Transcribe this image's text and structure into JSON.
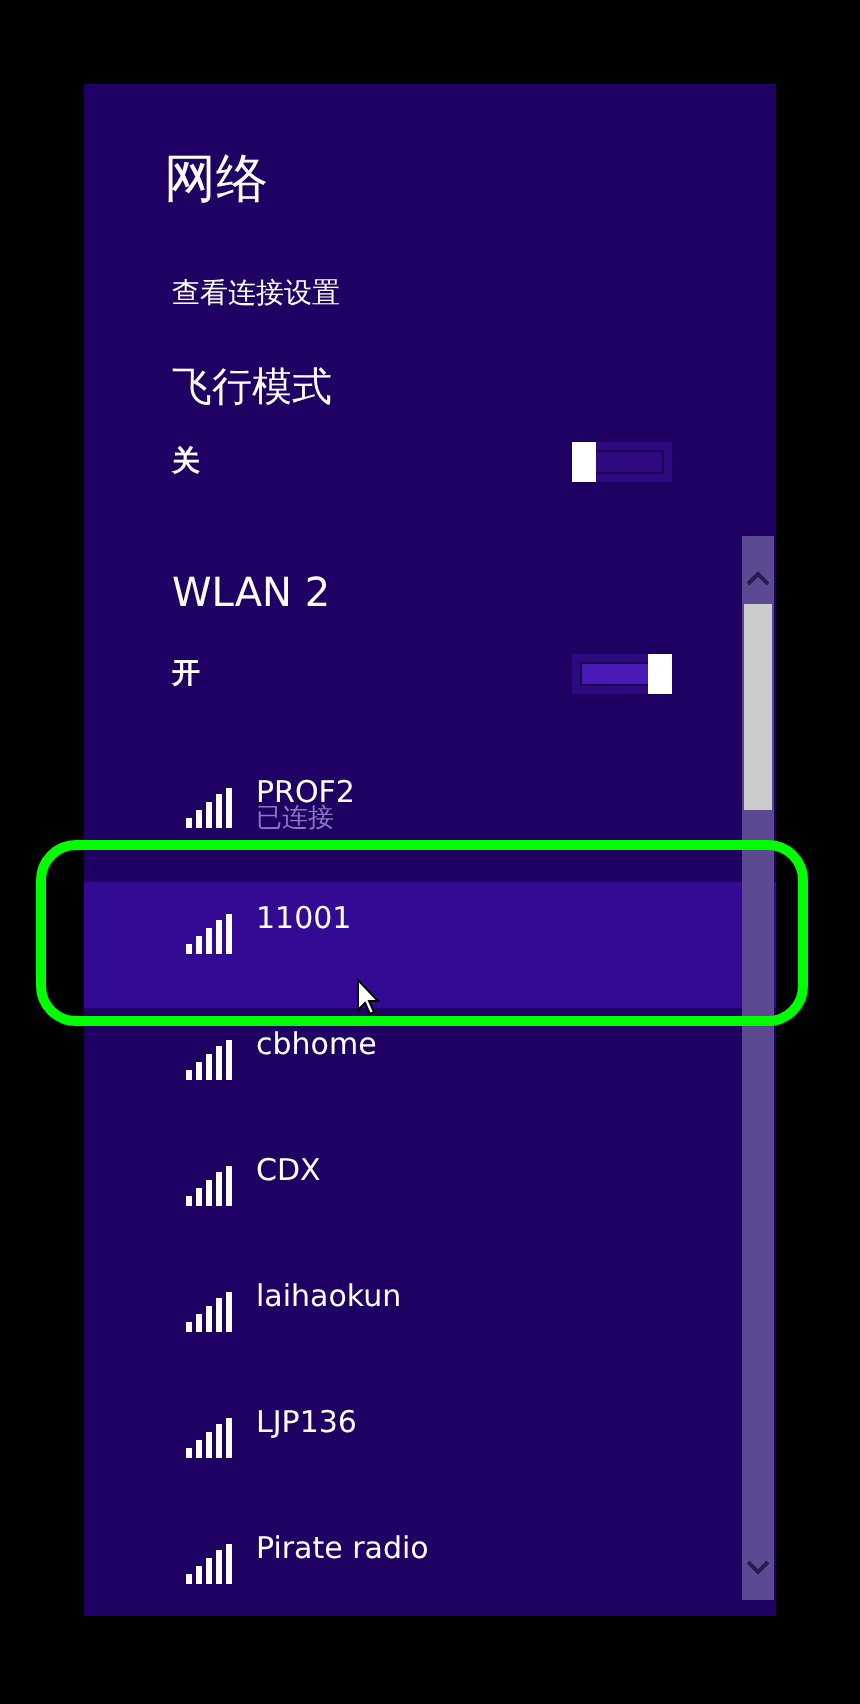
{
  "title": "网络",
  "connection_link": "查看连接设置",
  "airplane_mode": {
    "label": "飞行模式",
    "state_label": "关",
    "on": false
  },
  "wlan": {
    "label": "WLAN 2",
    "state_label": "开",
    "on": true
  },
  "networks": [
    {
      "name": "PROF2",
      "status": "已连接",
      "selected": false
    },
    {
      "name": "11001",
      "selected": true
    },
    {
      "name": "cbhome",
      "selected": false
    },
    {
      "name": "CDX",
      "selected": false
    },
    {
      "name": "laihaokun",
      "selected": false
    },
    {
      "name": "LJP136",
      "selected": false
    },
    {
      "name": "Pirate radio",
      "selected": false
    }
  ]
}
